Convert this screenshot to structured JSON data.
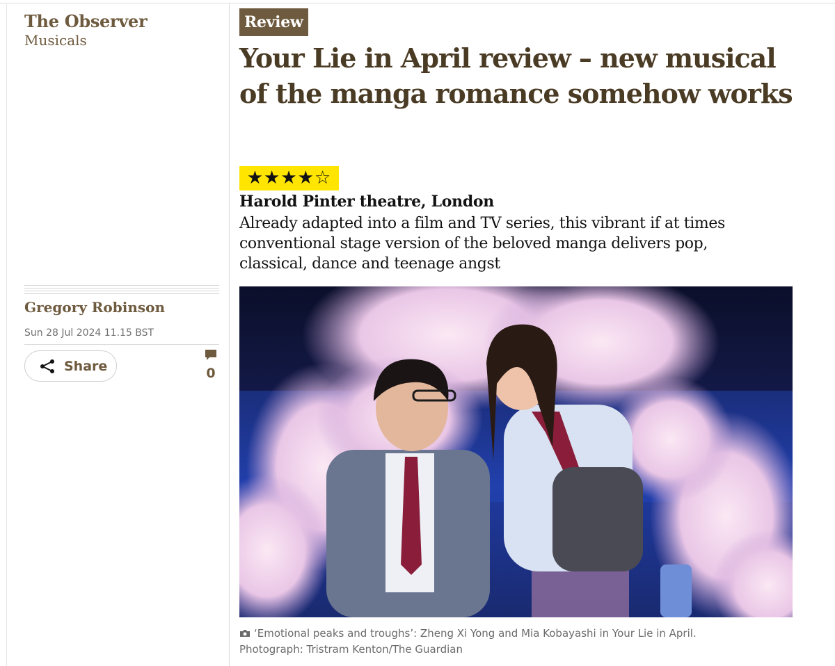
{
  "masthead": {
    "publication": "The Observer",
    "section": "Musicals"
  },
  "article": {
    "kicker": "Review",
    "headline": "Your Lie in April review – new musical of the manga romance somehow works",
    "rating": {
      "stars": 4,
      "max": 5,
      "display": "★★★★☆"
    },
    "venue": "Harold Pinter theatre, London",
    "standfirst": "Already adapted into a film and TV series, this vibrant if at times conventional stage version of the beloved manga delivers pop, classical, dance and teenage angst"
  },
  "byline": {
    "author": "Gregory Robinson",
    "date": "Sun 28 Jul 2024 11.15 BST"
  },
  "actions": {
    "share_label": "Share",
    "comment_count": "0"
  },
  "image": {
    "caption": "‘Emotional peaks and troughs’: Zheng Xi Yong and Mia Kobayashi in Your Lie in April.",
    "credit": "Photograph: Tristram Kenton/The Guardian"
  },
  "colors": {
    "brand_brown": "#6e5a3e",
    "headline": "#4a3b24",
    "star_bg": "#ffe500"
  }
}
